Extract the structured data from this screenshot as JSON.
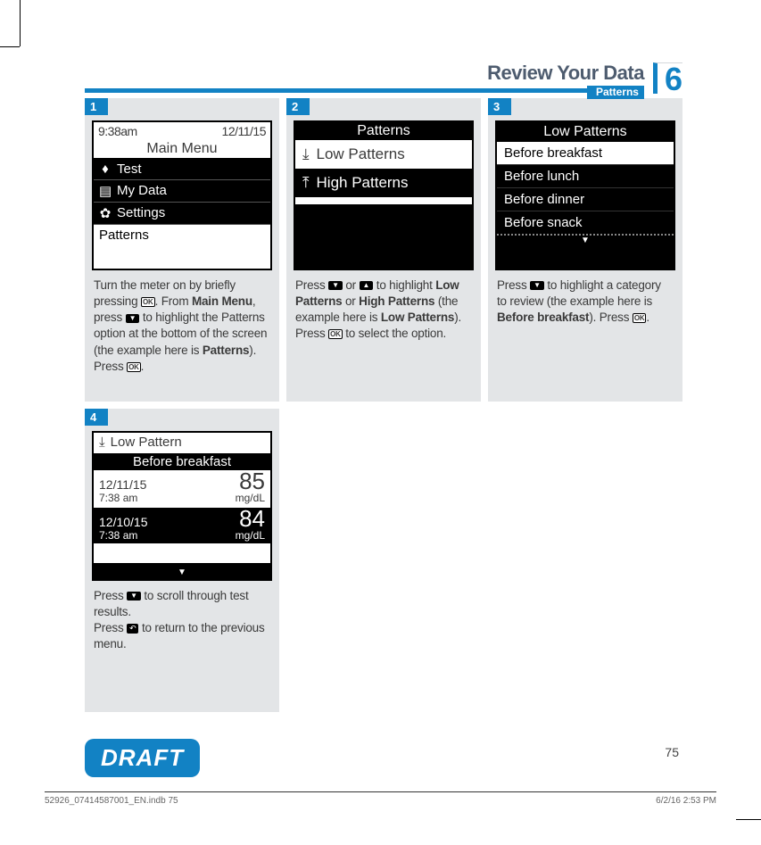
{
  "header": {
    "title": "Review Your Data",
    "subtitle": "Patterns",
    "chapter": "6"
  },
  "page_number": "75",
  "draft_label": "DRAFT",
  "footer": {
    "left": "52926_07414587001_EN.indb   75",
    "right": "6/2/16   2:53 PM"
  },
  "steps": {
    "s1": {
      "num": "1",
      "screen": {
        "time": "9:38am",
        "date": "12/11/15",
        "title": "Main Menu",
        "items": [
          "Test",
          "My Data",
          "Settings"
        ],
        "footer_item": "Patterns"
      },
      "cap_parts": {
        "a": "Turn the meter on by briefly pressing ",
        "b": ". From ",
        "c": "Main Menu",
        "d": ", press ",
        "e": " to highlight the Patterns option at the bottom of the screen (the example here is ",
        "f": "Patterns",
        "g": "). Press ",
        "h": "."
      }
    },
    "s2": {
      "num": "2",
      "screen": {
        "title": "Patterns",
        "items": [
          "Low Patterns",
          "High Patterns"
        ]
      },
      "cap_parts": {
        "a": "Press ",
        "b": " or ",
        "c": " to highlight ",
        "d": "Low Patterns",
        "e": " or ",
        "f": "High Patterns",
        "g": " (the example here is ",
        "h": "Low Patterns",
        "i": "). Press ",
        "j": " to select the option."
      }
    },
    "s3": {
      "num": "3",
      "screen": {
        "title": "Low Patterns",
        "items": [
          "Before breakfast",
          "Before lunch",
          "Before dinner",
          "Before snack"
        ]
      },
      "cap_parts": {
        "a": "Press ",
        "b": " to highlight a category to review (the example here is ",
        "c": "Before breakfast",
        "d": "). Press ",
        "e": "."
      }
    },
    "s4": {
      "num": "4",
      "screen": {
        "title": "Low Pattern",
        "subtitle": "Before breakfast",
        "entries": [
          {
            "date": "12/11/15",
            "value": "85",
            "time": "7:38 am",
            "unit": "mg/dL"
          },
          {
            "date": "12/10/15",
            "value": "84",
            "time": "7:38 am",
            "unit": "mg/dL"
          }
        ]
      },
      "cap_parts": {
        "a": "Press ",
        "b": " to scroll through test results.",
        "c": "Press ",
        "d": " to return to the previous menu."
      }
    }
  }
}
